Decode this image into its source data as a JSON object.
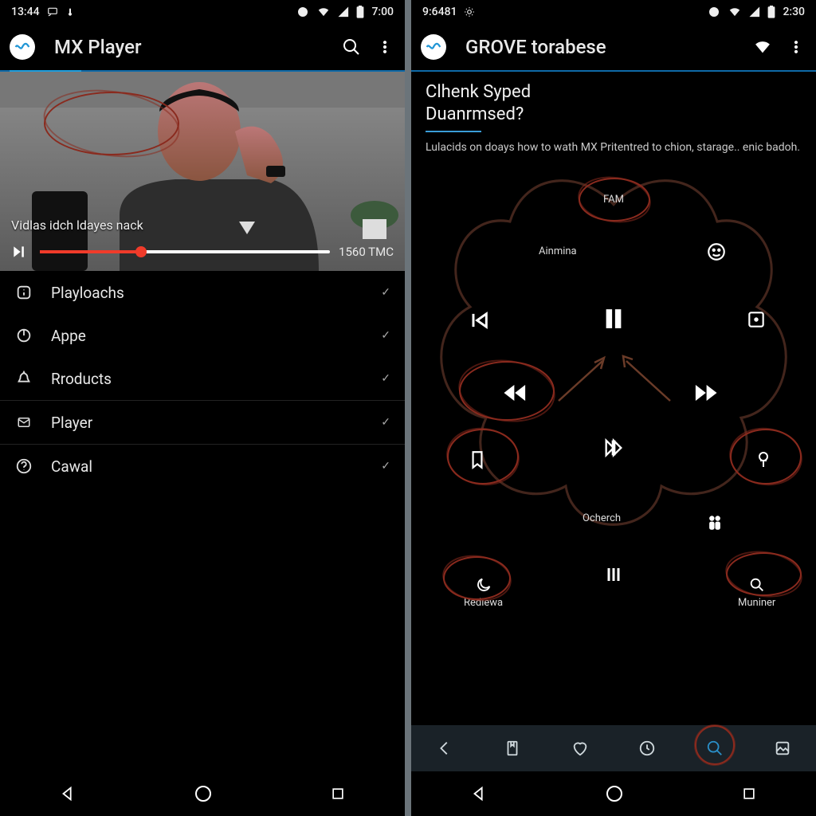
{
  "left": {
    "statusbar": {
      "clock": "13:44",
      "battery": "7:00"
    },
    "appbar": {
      "title": "MX Player"
    },
    "video": {
      "caption": "Vidlas idch ldayes nack",
      "time": "1560 TMC",
      "progress_pct": 35
    },
    "menu": [
      {
        "icon": "info-icon",
        "label": "Playloachs"
      },
      {
        "icon": "power-icon",
        "label": "Appe"
      },
      {
        "icon": "bell-icon",
        "label": "Rroducts"
      },
      {
        "icon": "mail-icon",
        "label": "Player"
      },
      {
        "icon": "help-icon",
        "label": "Cawal"
      }
    ]
  },
  "right": {
    "statusbar": {
      "clock": "9:6481",
      "battery": "2:30"
    },
    "appbar": {
      "title": "GROVE torabese"
    },
    "desc": {
      "title_line1": "Clhenk Syped",
      "title_line2": "Duanrmsed?",
      "body": "Lulacids on doays how to wath MX Pritentred to chion, starage.. enic badoh."
    },
    "controls": {
      "top": "FAM",
      "upper": "Ainmina",
      "lower": "Ocherch",
      "bl": "Rediewa",
      "br": "Muniner"
    }
  }
}
